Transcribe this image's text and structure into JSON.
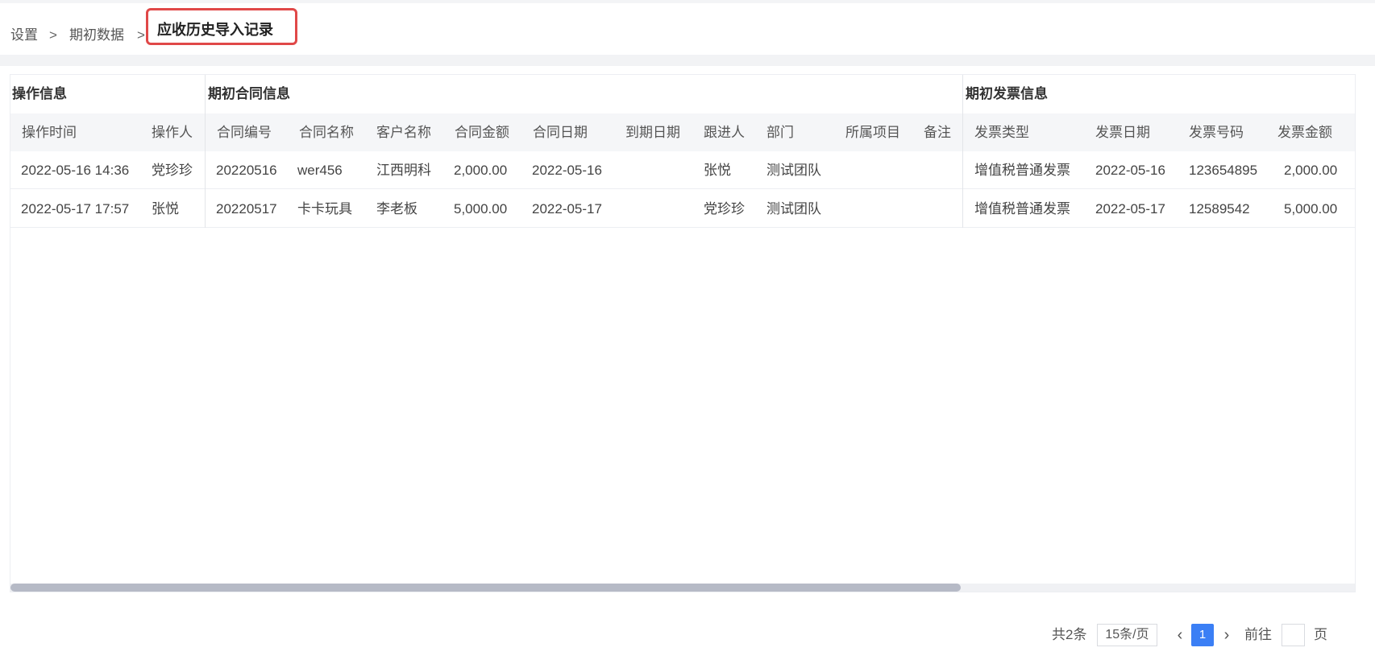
{
  "breadcrumb": {
    "items": [
      "设置",
      "期初数据"
    ],
    "separator": ">",
    "current": "应收历史导入记录"
  },
  "table": {
    "groups": [
      "操作信息",
      "期初合同信息",
      "期初发票信息"
    ],
    "columns": [
      "操作时间",
      "操作人",
      "合同编号",
      "合同名称",
      "客户名称",
      "合同金额",
      "合同日期",
      "到期日期",
      "跟进人",
      "部门",
      "所属项目",
      "备注",
      "发票类型",
      "发票日期",
      "发票号码",
      "发票金额"
    ],
    "rows": [
      [
        "2022-05-16 14:36",
        "党珍珍",
        "20220516",
        "wer456",
        "江西明科",
        "2,000.00",
        "2022-05-16",
        "",
        "张悦",
        "测试团队",
        "",
        "",
        "增值税普通发票",
        "2022-05-16",
        "123654895",
        "2,000.00"
      ],
      [
        "2022-05-17 17:57",
        "张悦",
        "20220517",
        "卡卡玩具",
        "李老板",
        "5,000.00",
        "2022-05-17",
        "",
        "党珍珍",
        "测试团队",
        "",
        "",
        "增值税普通发票",
        "2022-05-17",
        "12589542",
        "5,000.00"
      ]
    ]
  },
  "pagination": {
    "total": "共2条",
    "page_size": "15条/页",
    "prev": "‹",
    "current_page": "1",
    "next": "›",
    "goto_label": "前往",
    "goto_value": "",
    "page_suffix": "页"
  },
  "colors": {
    "accent": "#3b7ff5",
    "highlight_border": "#e04848",
    "header_bg": "#f5f6f8"
  }
}
